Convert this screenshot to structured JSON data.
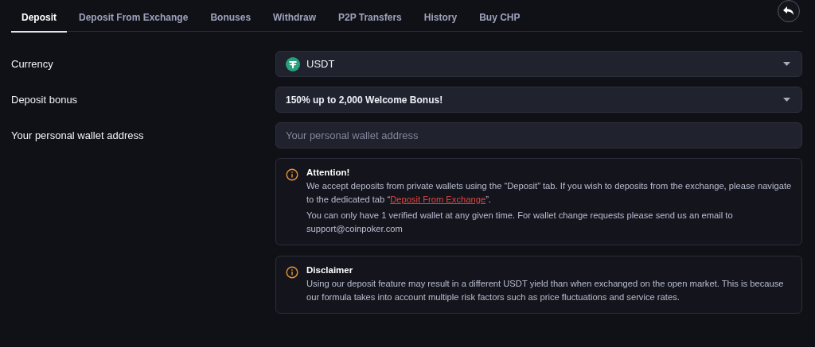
{
  "tabs": [
    {
      "label": "Deposit",
      "selected": true
    },
    {
      "label": "Deposit From Exchange",
      "selected": false
    },
    {
      "label": "Bonuses",
      "selected": false
    },
    {
      "label": "Withdraw",
      "selected": false
    },
    {
      "label": "P2P Transfers",
      "selected": false
    },
    {
      "label": "History",
      "selected": false
    },
    {
      "label": "Buy CHP",
      "selected": false
    }
  ],
  "fields": [
    {
      "kind": "select",
      "label": "Currency",
      "value": "USDT",
      "coin_icon": true
    },
    {
      "kind": "select",
      "label": "Deposit bonus",
      "value": "150% up to 2,000 Welcome Bonus!",
      "coin_icon": false
    },
    {
      "kind": "input",
      "label": "Your personal wallet address",
      "placeholder": "Your personal wallet address"
    }
  ],
  "notices": [
    {
      "title": "Attention!",
      "paragraphs": [
        {
          "before": "We accept deposits from private wallets using the “Deposit” tab. If you wish to deposits from the exchange, please navigate to the dedicated tab “",
          "link": "Deposit From Exchange",
          "after": "”."
        },
        {
          "before": "You can only have 1 verified wallet at any given time. For wallet change requests please send us an email to support@coinpoker.com"
        }
      ]
    },
    {
      "title": "Disclaimer",
      "paragraphs": [
        {
          "before": "Using our deposit feature may result in a different USDT yield than when exchanged on the open market. This is because our formula takes into account multiple risk factors such as price fluctuations and service rates."
        }
      ]
    }
  ]
}
